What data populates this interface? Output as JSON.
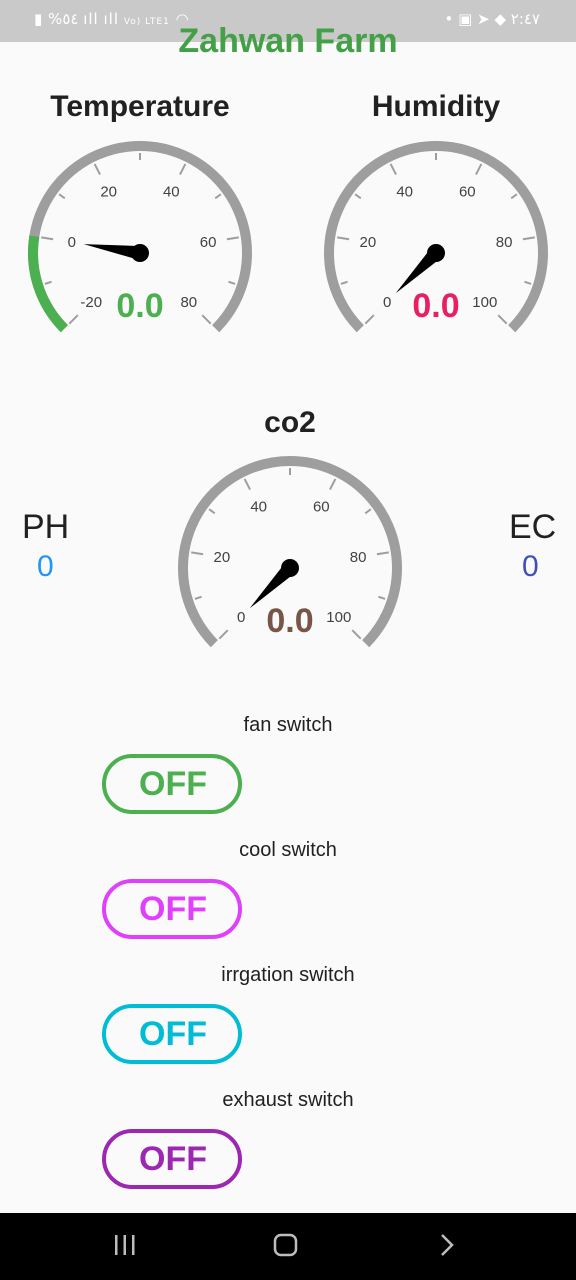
{
  "status_bar": {
    "left_text": "%٥٤",
    "network": "Vo) LTE1",
    "time": "٢:٤٧"
  },
  "app": {
    "title": "Zahwan Farm"
  },
  "gauges": {
    "temperature": {
      "title": "Temperature",
      "value": "0.0",
      "value_color": "#4caf50",
      "range_color": "#4caf50",
      "min": -20,
      "max": 80,
      "ticks": [
        "-20",
        "0",
        "20",
        "40",
        "60",
        "80"
      ]
    },
    "humidity": {
      "title": "Humidity",
      "value": "0.0",
      "value_color": "#e91e63",
      "min": 0,
      "max": 100,
      "ticks": [
        "0",
        "20",
        "40",
        "60",
        "80",
        "100"
      ]
    },
    "co2": {
      "title": "co2",
      "value": "0.0",
      "value_color": "#795548",
      "min": 0,
      "max": 100,
      "ticks": [
        "0",
        "20",
        "40",
        "60",
        "80",
        "100"
      ]
    }
  },
  "readings": {
    "ph": {
      "label": "PH",
      "value": "0",
      "color": "#2196f3"
    },
    "ec": {
      "label": "EC",
      "value": "0",
      "color": "#3f51b5"
    }
  },
  "switches": [
    {
      "label": "fan switch",
      "state": "OFF",
      "color": "#4caf50"
    },
    {
      "label": "cool switch",
      "state": "OFF",
      "color": "#e040fb"
    },
    {
      "label": "irrgation switch",
      "state": "OFF",
      "color": "#00bcd4"
    },
    {
      "label": "exhaust switch",
      "state": "OFF",
      "color": "#9c27b0"
    }
  ],
  "colors": {
    "gauge_track": "#9e9e9e",
    "needle": "#000000",
    "title": "#43a047"
  }
}
